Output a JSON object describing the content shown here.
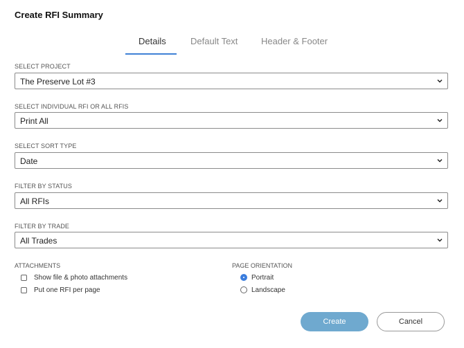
{
  "dialog": {
    "title": "Create RFI Summary"
  },
  "tabs": [
    {
      "label": "Details",
      "active": true
    },
    {
      "label": "Default Text",
      "active": false
    },
    {
      "label": "Header & Footer",
      "active": false
    }
  ],
  "fields": {
    "project": {
      "label": "SELECT PROJECT",
      "value": "The Preserve Lot #3"
    },
    "rfi": {
      "label": "SELECT INDIVIDUAL RFI OR ALL RFIS",
      "value": "Print All"
    },
    "sort": {
      "label": "SELECT SORT TYPE",
      "value": "Date"
    },
    "status": {
      "label": "FILTER BY STATUS",
      "value": "All RFIs"
    },
    "trade": {
      "label": "FILTER BY TRADE",
      "value": "All Trades"
    }
  },
  "attachments": {
    "label": "ATTACHMENTS",
    "options": [
      {
        "label": "Show file & photo attachments",
        "checked": false
      },
      {
        "label": "Put one RFI per page",
        "checked": false
      }
    ]
  },
  "orientation": {
    "label": "PAGE ORIENTATION",
    "options": [
      {
        "label": "Portrait",
        "selected": true
      },
      {
        "label": "Landscape",
        "selected": false
      }
    ]
  },
  "buttons": {
    "create": "Create",
    "cancel": "Cancel"
  },
  "colors": {
    "accent": "#3f80d6",
    "create_bg": "#6fa9cf"
  }
}
